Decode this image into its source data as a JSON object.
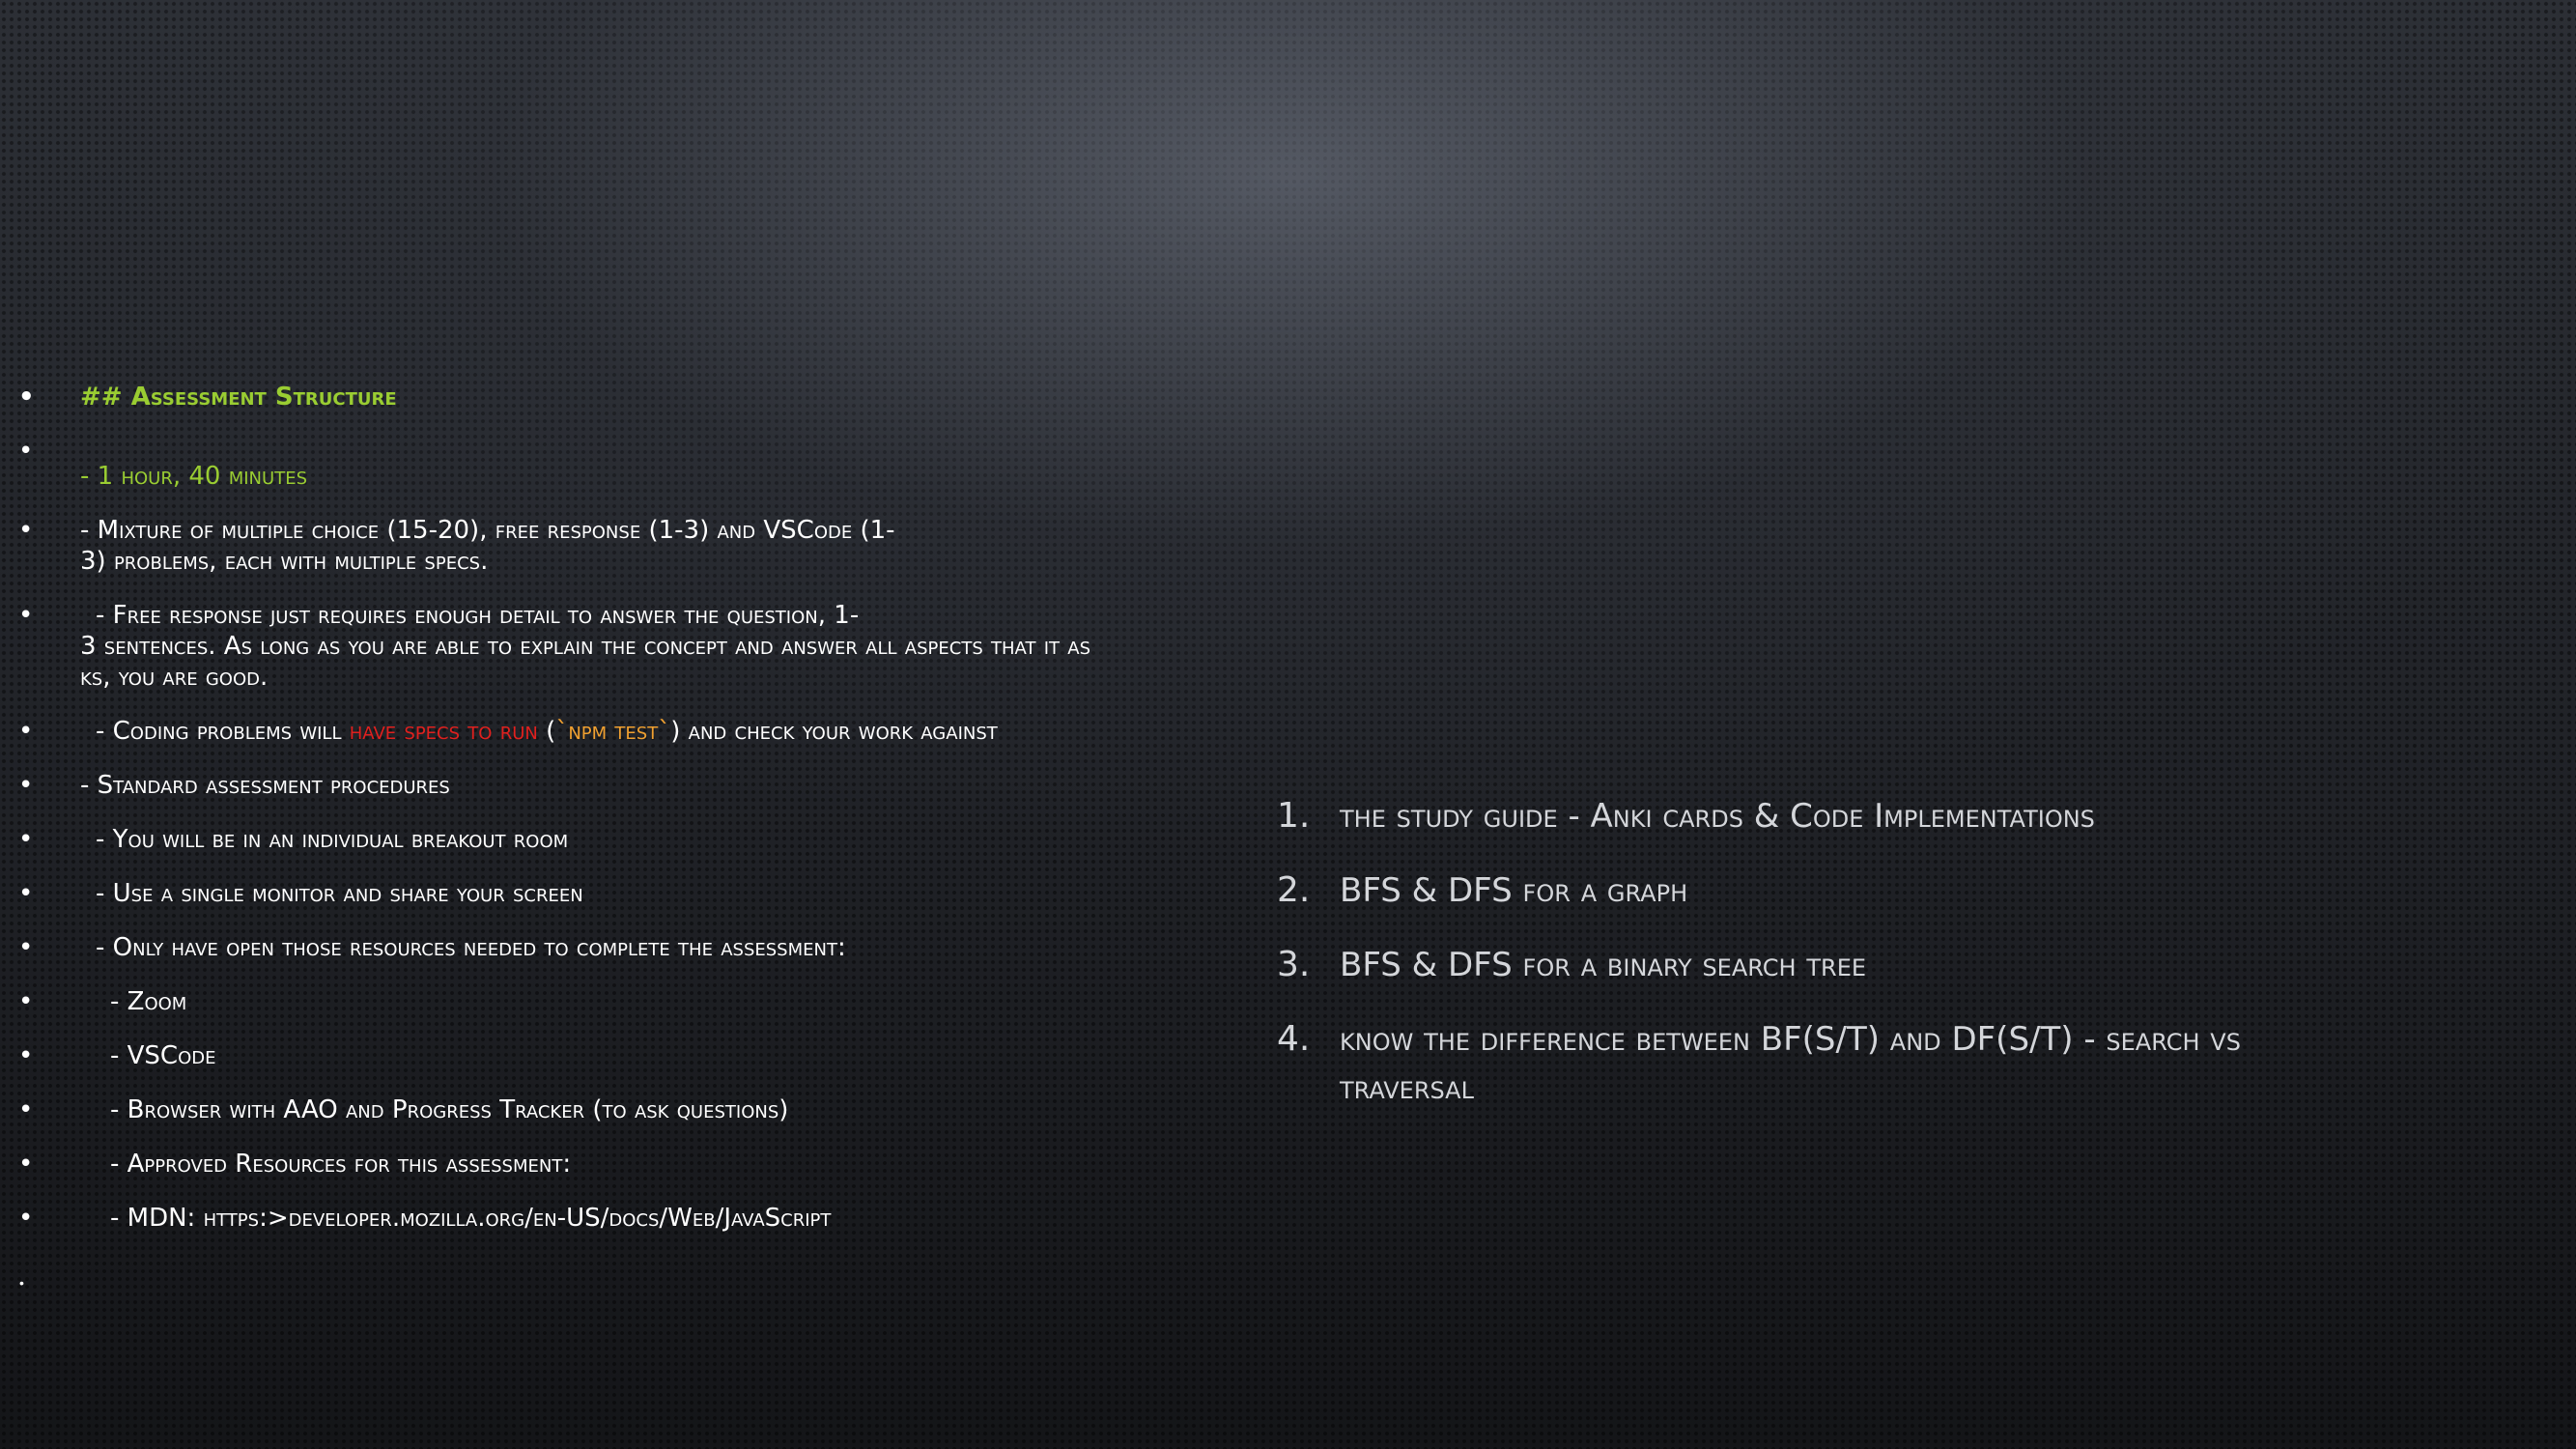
{
  "left_items": [
    {
      "text": "## Assessment Structure"
    },
    {
      "text": "- 1 hour, 40 minutes"
    },
    {
      "text": "- Mixture of multiple choice (15-20), free response (1-3) and VSCode (1-",
      "text2": "3) problems, each with multiple specs."
    },
    {
      "text": "- Free response just requires enough detail to answer the question, 1-",
      "text2": "3 sentences. As long as you are able to explain the concept and answer all aspects that it as",
      "text3": "ks, you are good."
    },
    {
      "pre": "- Coding problems will ",
      "red": "have specs to run",
      "mid": " (",
      "orange": "`npm test`",
      "post": ") and check your work against"
    },
    {
      "text": "- Standard assessment procedures"
    },
    {
      "text": "- You will be in an individual breakout room"
    },
    {
      "text": "- Use a single monitor and share your screen"
    },
    {
      "text": "- Only have open those resources needed to complete the assessment:"
    },
    {
      "text": "- Zoom"
    },
    {
      "text": "- VSCode"
    },
    {
      "text": "- Browser with AAO and Progress Tracker (to ask questions)"
    },
    {
      "text": "- Approved Resources for this assessment:"
    },
    {
      "text": "- MDN: https:>developer.mozilla.org/en-US/docs/Web/JavaScript"
    }
  ],
  "right_items": [
    {
      "num": "1.",
      "text": "the study guide - Anki cards & Code Implementations"
    },
    {
      "num": "2.",
      "text": "BFS & DFS for a graph"
    },
    {
      "num": "3.",
      "text": "BFS & DFS for a binary search tree"
    },
    {
      "num": "4.",
      "text": "know the difference between BF(S/T) and DF(S/T) - search vs traversal"
    }
  ],
  "colors": {
    "accent_green": "#9acd32",
    "highlight_red": "#e0201e",
    "highlight_orange": "#f0a030",
    "text_white": "#ffffff",
    "text_grey": "#d4d6da"
  }
}
